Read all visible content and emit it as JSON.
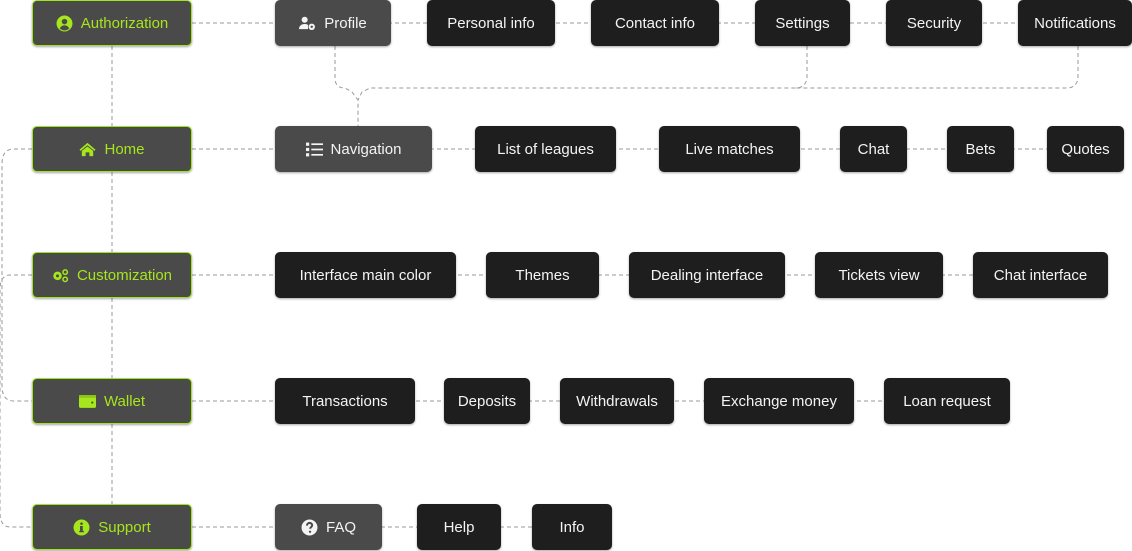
{
  "colors": {
    "accent": "#a6e61c",
    "main_bg": "#4a4a4a",
    "leaf_bg": "#1e1e1e",
    "line": "#9a9a9a"
  },
  "rows": [
    {
      "main": {
        "label": "Authorization",
        "icon": "user-circle-icon"
      },
      "hub": {
        "label": "Profile",
        "icon": "user-gear-icon"
      },
      "items": [
        "Personal info",
        "Contact info",
        "Settings",
        "Security",
        "Notifications"
      ]
    },
    {
      "main": {
        "label": "Home",
        "icon": "home-icon"
      },
      "hub": {
        "label": "Navigation",
        "icon": "list-icon"
      },
      "items": [
        "List of leagues",
        "Live matches",
        "Chat",
        "Bets",
        "Quotes"
      ]
    },
    {
      "main": {
        "label": "Customization",
        "icon": "gears-icon"
      },
      "items": [
        "Interface main color",
        "Themes",
        "Dealing interface",
        "Tickets view",
        "Chat interface"
      ]
    },
    {
      "main": {
        "label": "Wallet",
        "icon": "wallet-icon"
      },
      "items": [
        "Transactions",
        "Deposits",
        "Withdrawals",
        "Exchange money",
        "Loan request"
      ]
    },
    {
      "main": {
        "label": "Support",
        "icon": "info-icon"
      },
      "hub": {
        "label": "FAQ",
        "icon": "question-icon"
      },
      "items": [
        "Help",
        "Info"
      ]
    }
  ]
}
